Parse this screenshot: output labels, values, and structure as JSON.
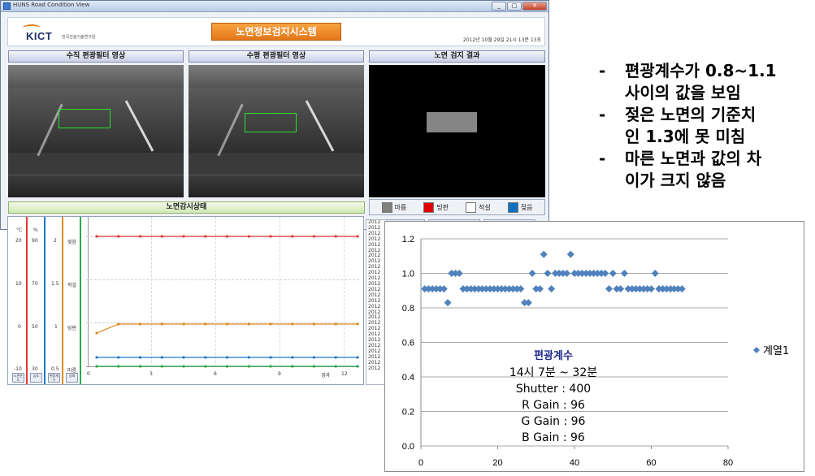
{
  "window": {
    "title": "HUNS Road Condition View",
    "buttons": [
      "_",
      "□",
      "✕"
    ]
  },
  "header": {
    "logo_text": "KICT",
    "logo_sub": "한국건설기술연구원",
    "system_title": "노면정보검지시스템",
    "datetime": "2012년 10월 29일 21시 13분 13초"
  },
  "panels": {
    "vertical_filter": "수직 편광필터 영상",
    "horizontal_filter": "수평 편광필터 영상",
    "detection_result": "노면 검지 결과",
    "monitoring": "노면감시상태"
  },
  "legend": [
    {
      "label": "마름",
      "color": "#808080"
    },
    {
      "label": "빙판",
      "color": "#e00000"
    },
    {
      "label": "적설",
      "color": "#ffffff"
    },
    {
      "label": "젖음",
      "color": "#1070c0"
    }
  ],
  "monitor": {
    "col_headers": [
      "°C",
      "%"
    ],
    "rows": [
      {
        "c": "20",
        "pct": "90",
        "idx": "2",
        "state": "젖음"
      },
      {
        "c": "10",
        "pct": "70",
        "idx": "1.5",
        "state": "적설"
      },
      {
        "c": "0",
        "pct": "50",
        "idx": "1",
        "state": "빙판"
      },
      {
        "c": "-10",
        "pct": "30",
        "idx": "0.5",
        "state": "마름"
      }
    ],
    "buttons": [
      "노면온도",
      "습도",
      "편광계수",
      "상태"
    ],
    "x_ticks": [
      "0",
      "3",
      "6",
      "9",
      "12"
    ],
    "x_unit": "경과",
    "line_colors": {
      "red": "#e53935",
      "orange": "#d98a1e",
      "blue": "#1e78c8",
      "green": "#2ea84a"
    }
  },
  "log_entries": [
    "2012",
    "2012",
    "2012",
    "2012",
    "2012",
    "2012",
    "2012",
    "2012",
    "2012",
    "2012",
    "2012",
    "2012",
    "2012",
    "2012",
    "2012",
    "2012",
    "2012",
    "2012",
    "2012",
    "2012",
    "2012",
    "2012",
    "2012",
    "2012",
    "2012",
    "2012",
    "2012"
  ],
  "notes": [
    {
      "line1": "편광계수가 0.8~1.1",
      "line2": "사이의 값을 보임"
    },
    {
      "line1": "젖은 노면의 기준치",
      "line2": "인 1.3에 못 미침"
    },
    {
      "line1": "마른 노면과 값의 차",
      "line2": "이가 크지 않음"
    }
  ],
  "chart_data": {
    "type": "scatter",
    "xlim": [
      0,
      80
    ],
    "ylim": [
      0.0,
      1.2
    ],
    "x_ticks": [
      "0",
      "20",
      "40",
      "60",
      "80"
    ],
    "y_ticks": [
      "0.0",
      "0.2",
      "0.4",
      "0.6",
      "0.8",
      "1.0",
      "1.2"
    ],
    "grid": "horizontal",
    "legend_position": "right",
    "marker_color": "#4f81bd",
    "series": [
      {
        "name": "계열1",
        "points": [
          [
            1,
            0.91
          ],
          [
            2,
            0.91
          ],
          [
            3,
            0.91
          ],
          [
            4,
            0.91
          ],
          [
            5,
            0.91
          ],
          [
            6,
            0.91
          ],
          [
            7,
            0.83
          ],
          [
            8,
            1.0
          ],
          [
            9,
            1.0
          ],
          [
            10,
            1.0
          ],
          [
            11,
            0.91
          ],
          [
            12,
            0.91
          ],
          [
            13,
            0.91
          ],
          [
            14,
            0.91
          ],
          [
            15,
            0.91
          ],
          [
            16,
            0.91
          ],
          [
            17,
            0.91
          ],
          [
            18,
            0.91
          ],
          [
            19,
            0.91
          ],
          [
            20,
            0.91
          ],
          [
            21,
            0.91
          ],
          [
            22,
            0.91
          ],
          [
            23,
            0.91
          ],
          [
            24,
            0.91
          ],
          [
            25,
            0.91
          ],
          [
            26,
            0.91
          ],
          [
            27,
            0.83
          ],
          [
            28,
            0.83
          ],
          [
            29,
            1.0
          ],
          [
            30,
            0.91
          ],
          [
            31,
            0.91
          ],
          [
            32,
            1.11
          ],
          [
            33,
            1.0
          ],
          [
            34,
            0.91
          ],
          [
            35,
            1.0
          ],
          [
            36,
            1.0
          ],
          [
            37,
            1.0
          ],
          [
            38,
            1.0
          ],
          [
            39,
            1.11
          ],
          [
            40,
            1.0
          ],
          [
            41,
            1.0
          ],
          [
            42,
            1.0
          ],
          [
            43,
            1.0
          ],
          [
            44,
            1.0
          ],
          [
            45,
            1.0
          ],
          [
            46,
            1.0
          ],
          [
            47,
            1.0
          ],
          [
            48,
            1.0
          ],
          [
            49,
            0.91
          ],
          [
            50,
            1.0
          ],
          [
            51,
            0.91
          ],
          [
            52,
            0.91
          ],
          [
            53,
            1.0
          ],
          [
            54,
            0.91
          ],
          [
            55,
            0.91
          ],
          [
            56,
            0.91
          ],
          [
            57,
            0.91
          ],
          [
            58,
            0.91
          ],
          [
            59,
            0.91
          ],
          [
            60,
            0.91
          ],
          [
            61,
            1.0
          ],
          [
            62,
            0.91
          ],
          [
            63,
            0.91
          ],
          [
            64,
            0.91
          ],
          [
            65,
            0.91
          ],
          [
            66,
            0.91
          ],
          [
            67,
            0.91
          ],
          [
            68,
            0.91
          ]
        ]
      }
    ],
    "annotation": {
      "title": "편광계수",
      "lines": [
        "14시 7분 ~ 32분",
        "Shutter :  400",
        "R Gain : 96",
        "G Gain : 96",
        "B Gain : 96"
      ]
    }
  }
}
